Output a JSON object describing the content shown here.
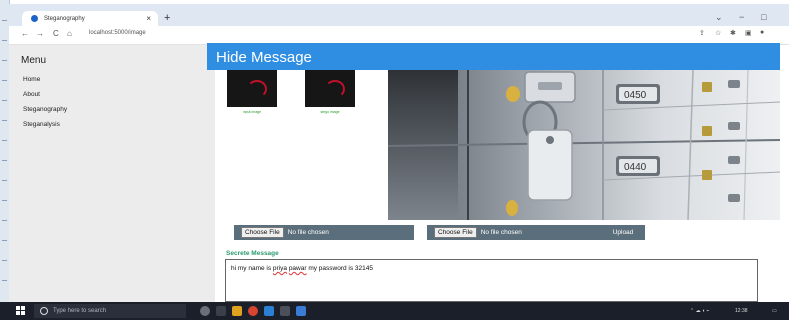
{
  "browser": {
    "tab_title": "Steganography",
    "tab_close": "×",
    "new_tab": "+",
    "url": "localhost:5000/image",
    "nav_back": "←",
    "nav_forward": "→",
    "nav_reload": "C",
    "nav_home": "⌂",
    "win_minimize": "−",
    "win_restore": "□",
    "win_chevron": "⌄"
  },
  "sidebar": {
    "title": "Menu",
    "items": [
      {
        "label": "Home"
      },
      {
        "label": "About"
      },
      {
        "label": "Steganography"
      },
      {
        "label": "Steganalysis"
      }
    ]
  },
  "header": {
    "title": "Hide Message"
  },
  "thumbnails": [
    {
      "caption": "input image"
    },
    {
      "caption": "stego image"
    }
  ],
  "photo": {
    "locker_numbers": [
      "0450",
      "0440"
    ]
  },
  "file_inputs": [
    {
      "button": "Choose File",
      "status": "No file chosen"
    },
    {
      "button": "Choose File",
      "status": "No file chosen"
    }
  ],
  "upload_label": "Upload",
  "message": {
    "label": "Secrete Message",
    "text_pre": "hi my name is ",
    "text_sq1": "priya",
    "text_sp": " ",
    "text_sq2": "pawar",
    "text_post": " my password is 32145"
  },
  "taskbar": {
    "search_placeholder": "Type here to search",
    "time": "12:38"
  },
  "colors": {
    "accent": "#2f8ee2",
    "file_bar": "#5b6e7b",
    "label_green": "#2a9a6e"
  }
}
